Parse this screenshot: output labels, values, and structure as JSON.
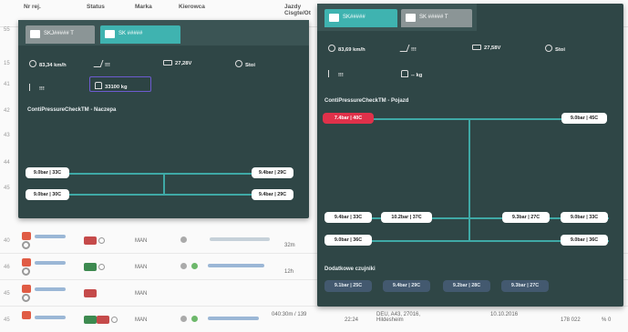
{
  "background_table": {
    "headers": [
      "Nr rej.",
      "Status",
      "Marka",
      "Kierowca",
      "Jazdy Cisgte/Ot"
    ],
    "row_numbers": [
      "55",
      "15",
      "41",
      "42",
      "43",
      "44",
      "45",
      "40",
      "46",
      "45"
    ],
    "rows": [
      {
        "brand": "MAN",
        "status_text": "",
        "dist": "32m"
      },
      {
        "brand": "MAN",
        "status_text": "",
        "dist": "12h"
      },
      {
        "brand": "MAN",
        "status_text": "",
        "dist": ""
      },
      {
        "brand": "MAN",
        "status_text": "DEU, A43, 27016, Hildesheim",
        "dist": "040:30m / 139",
        "time": "22:24",
        "date": "10.10.2016",
        "extra": "178 022",
        "extra2": "% 0"
      }
    ]
  },
  "panel_left": {
    "tabs": [
      {
        "label": "SKJ##### T",
        "state": "inactive"
      },
      {
        "label": "SK #####",
        "state": "active"
      }
    ],
    "stats": {
      "speed": "83,34 km/h",
      "signal1": "!!!",
      "voltage": "27,28V",
      "status": "Stoi",
      "signal2": "!!!",
      "weight": "33100 kg"
    },
    "section_title": "ContiPressureCheckTM - Naczepa",
    "tyres": [
      "9.0bar | 33C",
      "9.4bar | 29C",
      "9.0bar | 30C",
      "9.4bar | 29C"
    ]
  },
  "panel_right": {
    "tabs": [
      {
        "label": "SK#####",
        "state": "active"
      },
      {
        "label": "SK ##### T",
        "state": "inactive"
      }
    ],
    "stats": {
      "speed": "83,69 km/h",
      "signal1": "!!!",
      "voltage": "27,58V",
      "status": "Stoi",
      "signal2": "!!!",
      "weight": "-- kg"
    },
    "section_title": "ContiPressureCheckTM - Pojazd",
    "tyres_top": [
      "7.4bar | 40C",
      "9.0bar | 45C"
    ],
    "tyres_mid": [
      "9.4bar | 33C",
      "10.2bar | 37C",
      "9.3bar | 27C",
      "9.0bar | 33C"
    ],
    "tyres_bottom": [
      "9.0bar | 36C",
      "9.0bar | 36C"
    ],
    "reserve_title": "Dodatkowe czujniki",
    "reserve": [
      "9.1bar | 25C",
      "9.4bar | 29C",
      "9.2bar | 28C",
      "9.3bar | 27C"
    ]
  },
  "colors": {
    "panel_bg": "#2f4646",
    "tab_active": "#3fb3b0",
    "tab_inactive": "#8b9596",
    "line": "#3fa9a6",
    "alert": "#e0314a",
    "weight_border": "#6d5bd0"
  }
}
